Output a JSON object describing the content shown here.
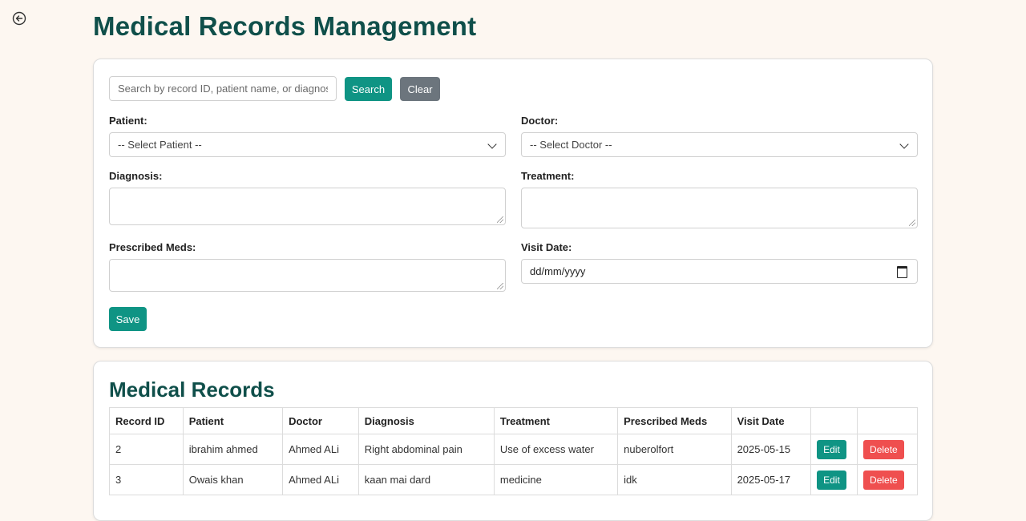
{
  "page": {
    "title": "Medical Records Management"
  },
  "search": {
    "placeholder": "Search by record ID, patient name, or diagnosis",
    "search_label": "Search",
    "clear_label": "Clear"
  },
  "form": {
    "patient_label": "Patient:",
    "patient_value": "-- Select Patient --",
    "doctor_label": "Doctor:",
    "doctor_value": "-- Select Doctor --",
    "diagnosis_label": "Diagnosis:",
    "treatment_label": "Treatment:",
    "meds_label": "Prescribed Meds:",
    "visit_date_label": "Visit Date:",
    "visit_date_value": "dd/mm/yyyy",
    "save_label": "Save"
  },
  "records": {
    "title": "Medical Records",
    "headers": [
      "Record ID",
      "Patient",
      "Doctor",
      "Diagnosis",
      "Treatment",
      "Prescribed Meds",
      "Visit Date",
      "",
      ""
    ],
    "rows": [
      {
        "id": "2",
        "patient": "ibrahim ahmed",
        "doctor": "Ahmed ALi",
        "diagnosis": "Right abdominal pain",
        "treatment": "Use of excess water",
        "meds": "nuberolfort",
        "date": "2025-05-15",
        "edit": "Edit",
        "delete": "Delete"
      },
      {
        "id": "3",
        "patient": "Owais khan",
        "doctor": "Ahmed ALi",
        "diagnosis": "kaan mai dard",
        "treatment": "medicine",
        "meds": "idk",
        "date": "2025-05-17",
        "edit": "Edit",
        "delete": "Delete"
      }
    ]
  },
  "colors": {
    "accent": "#0f9484",
    "heading": "#0f4f4a",
    "clear": "#6c757d",
    "danger": "#ef4f4f",
    "background": "#fdf7f1"
  },
  "icons": {
    "back": "back-arrow-circle-icon",
    "select": "chevron-down-icon",
    "date": "calendar-icon"
  }
}
